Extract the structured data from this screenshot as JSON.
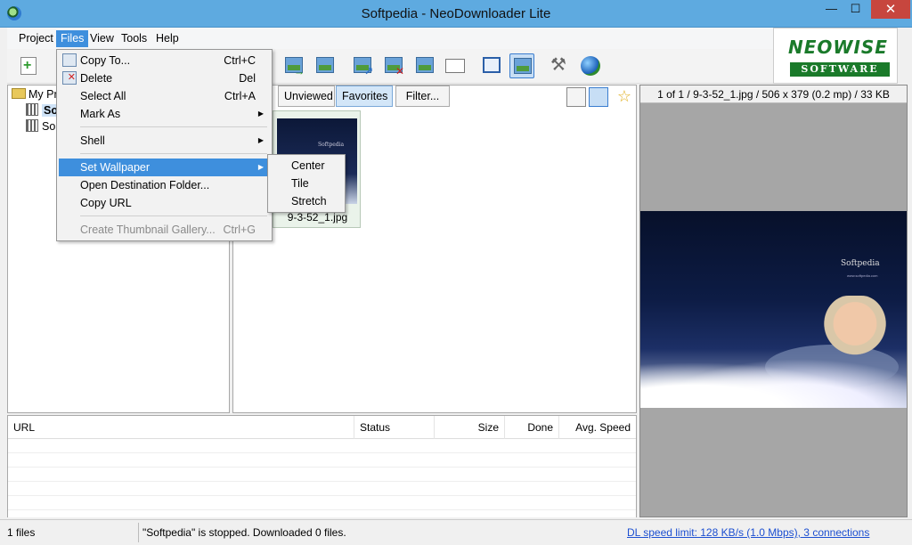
{
  "window": {
    "title": "Softpedia - NeoDownloader Lite",
    "minimize": "—",
    "maximize": "☐",
    "close": "✕"
  },
  "menubar": [
    "Project",
    "Files",
    "View",
    "Tools",
    "Help"
  ],
  "logo": {
    "line1": "NEOWISE",
    "line2": "SOFTWARE"
  },
  "tree": {
    "root": "My Pr",
    "items": [
      "So",
      "So"
    ]
  },
  "gallery": {
    "tabs": [
      "Unviewed",
      "Favorites",
      "Filter..."
    ],
    "thumbnail_caption": "9-3-52_1.jpg",
    "thumbnail_brand": "Softpedia",
    "watermark": "SOFTPEDIA"
  },
  "preview": {
    "info": "1 of 1 / 9-3-52_1.jpg / 506 x 379 (0.2 mp) / 33 KB",
    "brand": "Softpedia",
    "sub": "www.softpedia.com"
  },
  "downloads": {
    "columns": [
      "URL",
      "Status",
      "Size",
      "Done",
      "Avg. Speed"
    ]
  },
  "status": {
    "files": "1 files",
    "message": "\"Softpedia\" is stopped. Downloaded 0 files.",
    "speed_link": "DL speed limit: 128 KB/s (1.0 Mbps), 3 connections"
  },
  "files_menu": {
    "items": [
      {
        "label": "Copy To...",
        "shortcut": "Ctrl+C"
      },
      {
        "label": "Delete",
        "shortcut": "Del"
      },
      {
        "label": "Select All",
        "shortcut": "Ctrl+A"
      },
      {
        "label": "Mark As",
        "shortcut": ""
      },
      {
        "label": "Shell",
        "shortcut": ""
      },
      {
        "label": "Set Wallpaper",
        "shortcut": ""
      },
      {
        "label": "Open Destination Folder...",
        "shortcut": ""
      },
      {
        "label": "Copy URL",
        "shortcut": ""
      },
      {
        "label": "Create Thumbnail Gallery...",
        "shortcut": "Ctrl+G"
      }
    ],
    "submenu_arrow": "▶"
  },
  "wallpaper_submenu": [
    "Center",
    "Tile",
    "Stretch"
  ],
  "colors": {
    "titlebar": "#5eaae0",
    "highlight": "#3e8fdd",
    "close": "#c7463e",
    "logo_green": "#1a7a2a",
    "link": "#1c4fd1"
  }
}
